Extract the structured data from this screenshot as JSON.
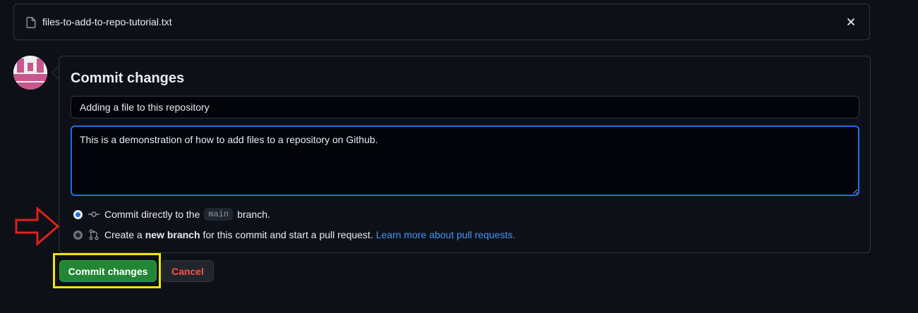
{
  "file": {
    "name": "files-to-add-to-repo-tutorial.txt",
    "icon": "file-icon",
    "close_icon": "close-icon"
  },
  "commit": {
    "heading": "Commit changes",
    "summary_value": "Adding a file to this repository",
    "description_value": "This is a demonstration of how to add files to a repository on Github.",
    "option_direct": {
      "prefix": "Commit directly to the",
      "branch": "main",
      "suffix": "branch.",
      "selected": true
    },
    "option_new_branch": {
      "prefix": "Create a",
      "bold": "new branch",
      "suffix": "for this commit and start a pull request.",
      "link": "Learn more about pull requests.",
      "selected": false
    }
  },
  "buttons": {
    "commit_label": "Commit changes",
    "cancel_label": "Cancel"
  },
  "annotations": {
    "arrow_color": "#e0201b",
    "highlight_color": "#f2e600"
  },
  "colors": {
    "background": "#0d1117",
    "commit_button": "#238636",
    "cancel_text": "#f85149",
    "link": "#4493f8",
    "focus_border": "#1f6feb"
  }
}
